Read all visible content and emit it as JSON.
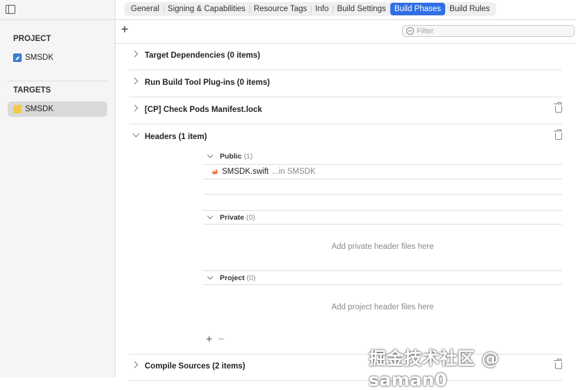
{
  "sidebar": {
    "project_header": "PROJECT",
    "project_item": "SMSDK",
    "targets_header": "TARGETS",
    "target_item": "SMSDK"
  },
  "tabs": [
    "General",
    "Signing & Capabilities",
    "Resource Tags",
    "Info",
    "Build Settings",
    "Build Phases",
    "Build Rules"
  ],
  "active_tab": "Build Phases",
  "toolbar": {
    "add_label": "+",
    "filter_placeholder": "Filter",
    "filter_value": ""
  },
  "phases": {
    "target_dependencies": "Target Dependencies (0 items)",
    "run_plugins": "Run Build Tool Plug-ins (0 items)",
    "check_pods": "[CP] Check Pods Manifest.lock",
    "headers": "Headers (1 item)",
    "compile_sources": "Compile Sources (2 items)"
  },
  "headers": {
    "public": {
      "label": "Public",
      "count": "(1)"
    },
    "file": {
      "name": "SMSDK.swift",
      "location": "...in SMSDK"
    },
    "private": {
      "label": "Private",
      "count": "(0)",
      "empty": "Add private header files here"
    },
    "project": {
      "label": "Project",
      "count": "(0)",
      "empty": "Add project header files here"
    },
    "add": "+",
    "remove": "−"
  },
  "watermark": "掘金技术社区 @ saman0"
}
